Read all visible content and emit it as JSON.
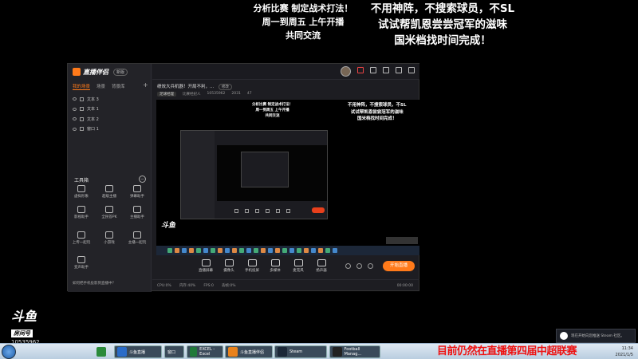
{
  "overlay": {
    "left_lines": [
      "分析比赛 制定战术打法！",
      "周一到周五 上午开播",
      "共同交流"
    ],
    "right_lines": [
      "不用神阵，不搜索球员，不SL",
      "试试帮凯恩尝尝冠军的滋味",
      "国米档找时间完成！"
    ]
  },
  "app": {
    "logo": "直播伴侣",
    "version": "新版",
    "tabs": [
      "我的场景",
      "场景",
      "背景库"
    ],
    "add": "+",
    "sources": [
      "文本 3",
      "文本 1",
      "文本 2",
      "窗口 1"
    ],
    "tools_title": "工具箱",
    "tools_min": "−",
    "tools": [
      "虚拟形象",
      "超级主播",
      "弹幕助手",
      "影视助手",
      "全民答PK",
      "主播助手",
      "上传一起玩",
      "小游戏",
      "主播一起玩",
      "变声助手"
    ],
    "tip": "如何把手机投影到直播中？",
    "room_title": "绩效大兵机器！开局不利，...",
    "room_edit": "修改",
    "room_meta": [
      "足球经理",
      "比赛经纪人",
      "10535962",
      "2031",
      "47"
    ],
    "controls": [
      "直播屏幕",
      "摄像头",
      "手机投屏",
      "多媒体",
      "麦克风",
      "扬声器"
    ],
    "go_live": "开始直播",
    "status": [
      "CPU:0%",
      "内存:40%",
      "FPS:0",
      "丢帧:0%",
      "00:00:00"
    ]
  },
  "preview": {
    "left_lines": [
      "分析比赛 制定战术打法！",
      "周一到周五 上午开播",
      "共同交流"
    ],
    "right_lines": [
      "不用神阵，不搜索球员，不SL",
      "试试帮凯恩尝尝冠军的滋味",
      "国米档找时间完成！"
    ],
    "logo": "斗鱼"
  },
  "brand": {
    "name": "斗鱼",
    "label": "房间号",
    "room": "10535962"
  },
  "steam_notification": "现在开始向您推送 Steam 社区。",
  "taskbar": {
    "items": [
      "斗鱼直播",
      "窗口",
      "EXCEL - Excel",
      "斗鱼直播伴侣",
      "Steam",
      "Football Manag..."
    ],
    "tray_text": "目前仍然在直播第四届中超联赛",
    "clock_time": "11:34",
    "clock_date": "2021/1/5"
  }
}
